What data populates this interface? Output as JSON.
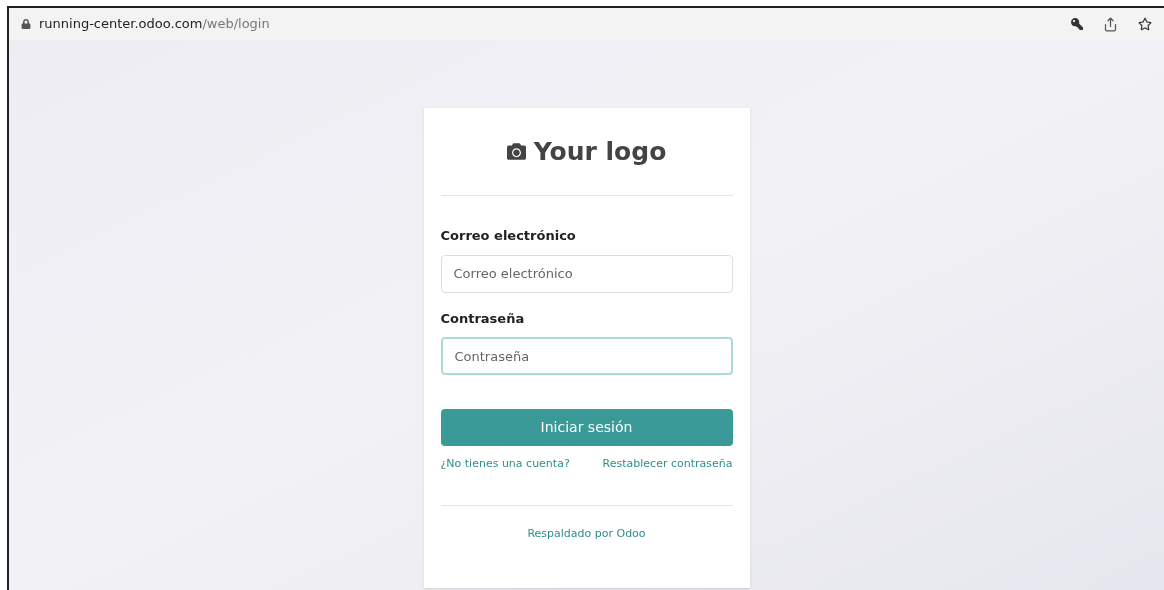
{
  "address_bar": {
    "host": "running-center.odoo.com",
    "path": "/web/login"
  },
  "login_card": {
    "logo_text": "Your logo",
    "fields": [
      {
        "label": "Correo electrónico",
        "placeholder": "Correo electrónico",
        "focused": false
      },
      {
        "label": "Contraseña",
        "placeholder": "Contraseña",
        "focused": true
      }
    ],
    "submit_button": "Iniciar sesión",
    "links": [
      "¿No tienes una cuenta?",
      "Restablecer contraseña"
    ],
    "footer": "Respaldado por Odoo"
  }
}
